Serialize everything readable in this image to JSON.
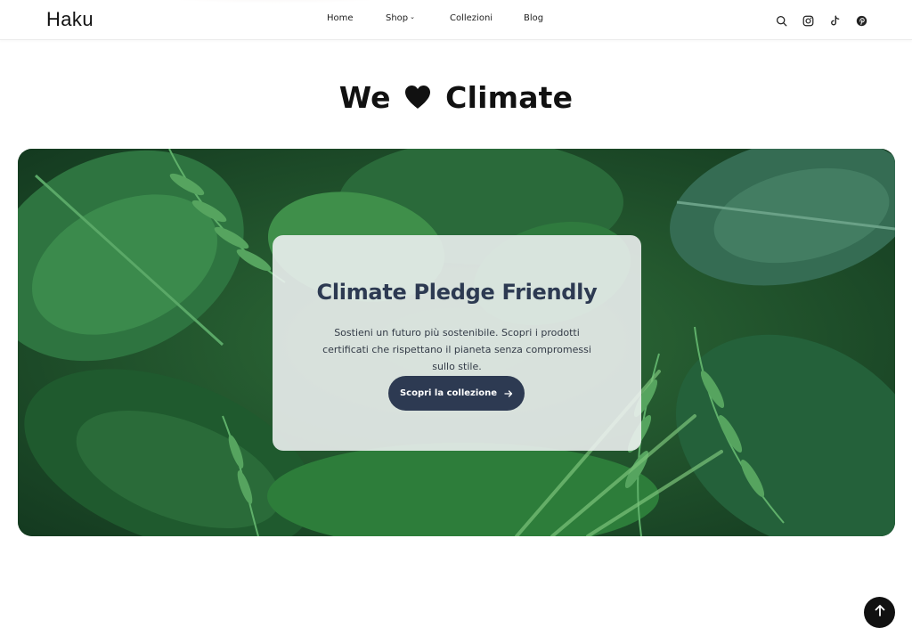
{
  "header": {
    "logo": "Haku",
    "nav": [
      {
        "label": "Home"
      },
      {
        "label": "Shop",
        "has_dropdown": true
      },
      {
        "label": "Collezioni"
      },
      {
        "label": "Blog"
      }
    ],
    "icons": [
      "search-icon",
      "instagram-icon",
      "tiktok-icon",
      "pinterest-icon"
    ]
  },
  "page": {
    "title_before": "We",
    "title_after": "Climate"
  },
  "hero": {
    "card_title": "Climate Pledge Friendly",
    "card_text": "Sostieni un futuro più sostenibile. Scopri i prodotti certificati che rispettano il pianeta senza compromessi sullo stile.",
    "cta_label": "Scopri la collezione"
  },
  "colors": {
    "accent": "#2d3a52",
    "leaf_dark": "#1d4d2b",
    "leaf_light": "#3d8a45"
  }
}
